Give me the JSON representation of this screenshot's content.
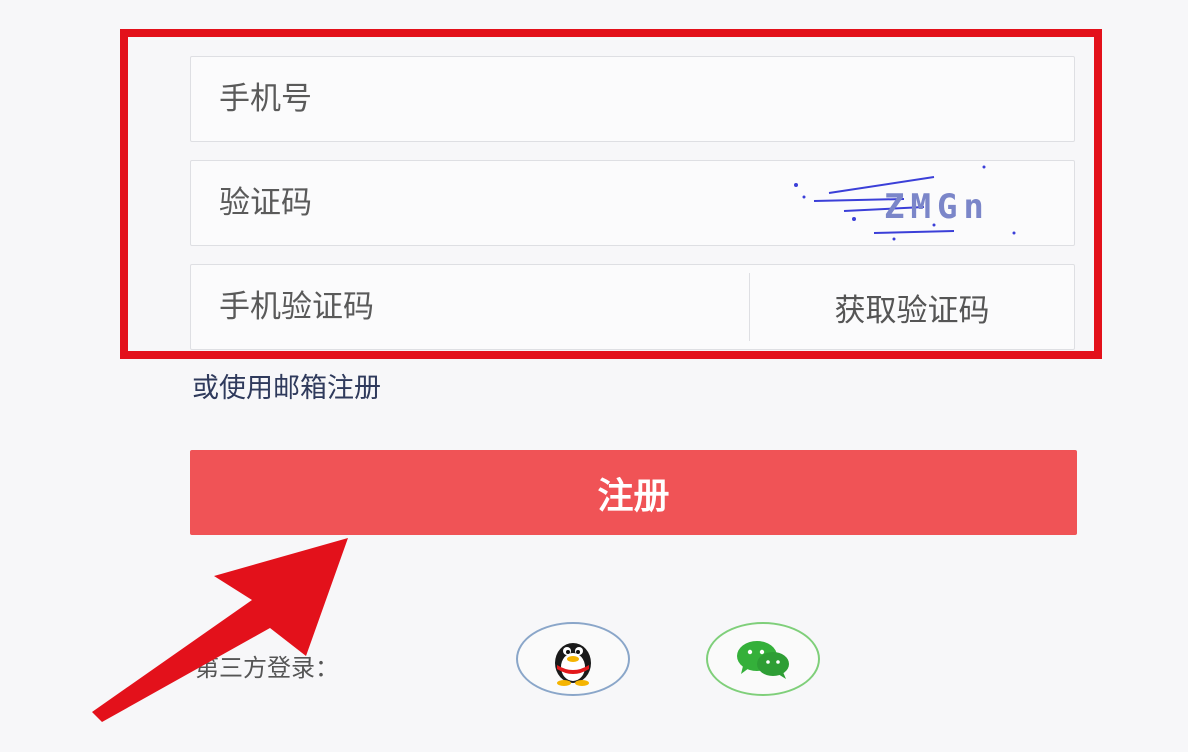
{
  "form": {
    "phone_placeholder": "手机号",
    "captcha_placeholder": "验证码",
    "captcha_image_text": "ZMGn",
    "sms_code_placeholder": "手机验证码",
    "get_code_label": "获取验证码",
    "email_register_link": "或使用邮箱注册",
    "register_button_label": "注册"
  },
  "third_party": {
    "label": "第三方登录：",
    "providers": [
      {
        "name": "QQ",
        "icon": "qq-penguin-icon",
        "color": "#8aa6c9"
      },
      {
        "name": "WeChat",
        "icon": "wechat-icon",
        "color": "#34b03a"
      }
    ]
  },
  "colors": {
    "highlight": "#e3111b",
    "register_button": "#f05356",
    "arrow": "#e3111b"
  }
}
